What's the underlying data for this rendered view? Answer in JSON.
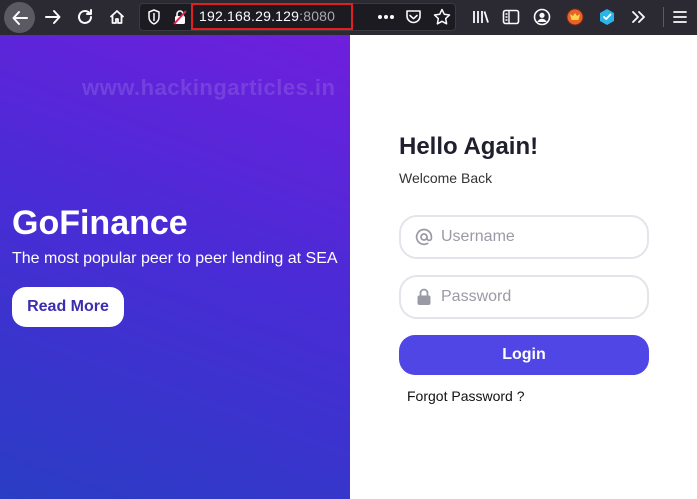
{
  "browser": {
    "url_host": "192.168.29.129",
    "url_port": ":8080"
  },
  "watermark": "www.hackingarticles.in",
  "hero": {
    "title": "GoFinance",
    "subtitle": "The most popular peer to peer lending at SEA",
    "button_label": "Read More"
  },
  "login": {
    "title": "Hello Again!",
    "subtitle": "Welcome Back",
    "username_placeholder": "Username",
    "password_placeholder": "Password",
    "username_value": "",
    "password_value": "",
    "submit_label": "Login",
    "forgot_label": "Forgot Password ?"
  },
  "colors": {
    "toolbar_bg": "#2b2a33",
    "url_highlight": "#e11f1f",
    "hero_gradient_top": "#6f1fdc",
    "hero_gradient_bottom": "#2a3dc4",
    "login_button": "#4f46e5",
    "read_more_text": "#3b2db0"
  },
  "icons": {
    "toolbar": [
      "back-arrow-icon",
      "forward-arrow-icon",
      "reload-icon",
      "home-icon",
      "shield-icon",
      "insecure-lock-icon",
      "more-dots-icon",
      "pocket-icon",
      "bookmark-star-icon",
      "library-icon",
      "sidebar-icon",
      "account-icon",
      "extension-fox-icon",
      "extension-cube-icon",
      "overflow-chevron-icon",
      "menu-hamburger-icon"
    ],
    "fields": [
      "at-sign-icon",
      "lock-icon"
    ]
  }
}
